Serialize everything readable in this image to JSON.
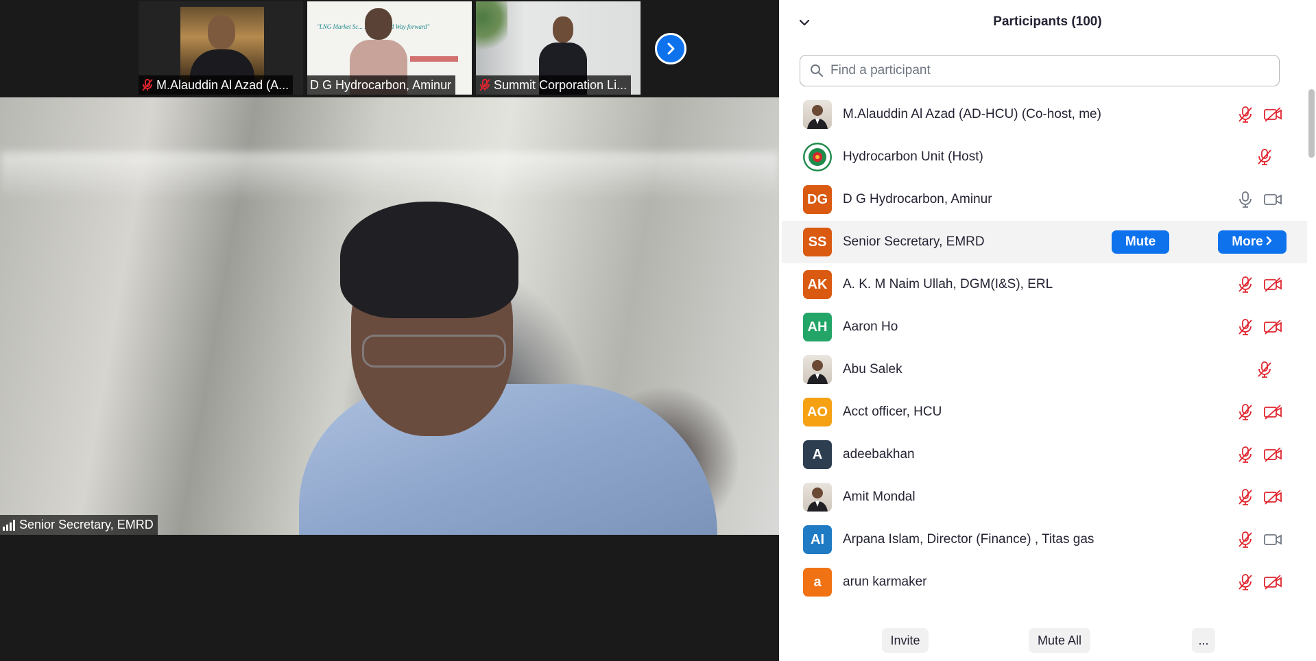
{
  "thumbnails": [
    {
      "name": "M.Alauddin Al Azad (A...",
      "muted": true
    },
    {
      "name": "D G Hydrocarbon, Aminur",
      "muted": false,
      "slide_text": "\"LNG Market Sc... ...enges and Way forward\""
    },
    {
      "name": "Summit Corporation Li...",
      "muted": true
    }
  ],
  "main_speaker": {
    "name": "Senior Secretary, EMRD"
  },
  "panel": {
    "title": "Participants (100)",
    "search_placeholder": "Find a participant",
    "participants": [
      {
        "initials": "",
        "name": "M.Alauddin Al Azad (AD-HCU) (Co-host, me)",
        "avatar_type": "photo",
        "mic": "muted",
        "video": "off"
      },
      {
        "initials": "",
        "name": "Hydrocarbon Unit (Host)",
        "avatar_type": "emblem",
        "mic": "muted",
        "video": "none"
      },
      {
        "initials": "DG",
        "name": "D G Hydrocarbon, Aminur",
        "color": "#d95a10",
        "mic": "on",
        "video": "on"
      },
      {
        "initials": "SS",
        "name": "Senior Secretary, EMRD",
        "color": "#d95a10",
        "hover": true,
        "mute_label": "Mute",
        "more_label": "More"
      },
      {
        "initials": "AK",
        "name": "A. K. M Naim Ullah, DGM(I&S), ERL",
        "color": "#d95a10",
        "mic": "muted",
        "video": "off"
      },
      {
        "initials": "AH",
        "name": "Aaron Ho",
        "color": "#23a567",
        "mic": "muted",
        "video": "off"
      },
      {
        "initials": "",
        "name": "Abu Salek",
        "avatar_type": "photo",
        "mic": "muted",
        "video": "none"
      },
      {
        "initials": "AO",
        "name": "Acct officer, HCU",
        "color": "#f5a113",
        "mic": "muted",
        "video": "off"
      },
      {
        "initials": "A",
        "name": "adeebakhan",
        "color": "#2d3e50",
        "mic": "muted",
        "video": "off"
      },
      {
        "initials": "",
        "name": "Amit Mondal",
        "avatar_type": "photo",
        "mic": "muted",
        "video": "off"
      },
      {
        "initials": "AI",
        "name": "Arpana Islam,  Director (Finance) , Titas gas",
        "color": "#1f7bc4",
        "mic": "muted",
        "video": "on"
      },
      {
        "initials": "a",
        "name": "arun karmaker",
        "color": "#f07212",
        "mic": "muted",
        "video": "off"
      }
    ]
  },
  "footer": {
    "invite": "Invite",
    "mute_all": "Mute All",
    "more": "..."
  },
  "colors": {
    "accent": "#0e72ed",
    "muted_red": "#e0242e",
    "icon_gray": "#6e7680"
  }
}
